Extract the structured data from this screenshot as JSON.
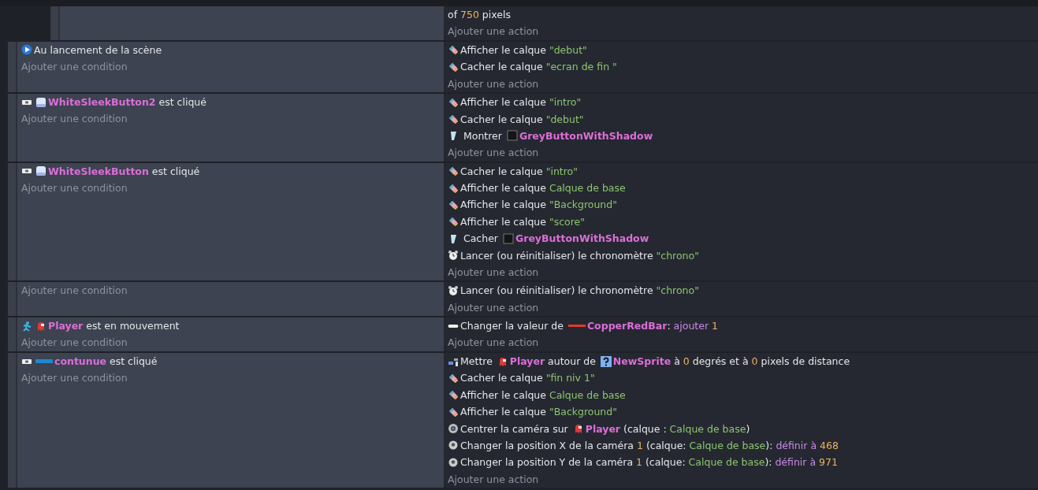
{
  "events": [
    {
      "kind": "sub-event",
      "actions": [
        {
          "kind": "continuation",
          "parts": [
            {
              "kind": "text",
              "text": "of "
            },
            {
              "kind": "number",
              "text": "750"
            },
            {
              "kind": "text",
              "text": " pixels"
            }
          ]
        }
      ],
      "add_action": "Ajouter une action"
    },
    {
      "kind": "event",
      "conditions": [
        {
          "kind": "scene-start",
          "parts": [
            {
              "kind": "text",
              "text": "Au lancement de la scène"
            }
          ]
        }
      ],
      "add_condition": "Ajouter une condition",
      "actions": [
        {
          "kind": "layer",
          "parts": [
            {
              "kind": "text",
              "text": "Afficher le calque "
            },
            {
              "kind": "string",
              "text": "\"debut\""
            }
          ]
        },
        {
          "kind": "layer",
          "parts": [
            {
              "kind": "text",
              "text": "Cacher le calque "
            },
            {
              "kind": "string",
              "text": "\"ecran de fin \""
            }
          ]
        }
      ],
      "add_action": "Ajouter une action"
    },
    {
      "kind": "event",
      "conditions": [
        {
          "kind": "mouse",
          "parts": [
            {
              "kind": "sleek-button"
            },
            {
              "kind": "object",
              "text": "WhiteSleekButton2"
            },
            {
              "kind": "text",
              "text": " est cliqué"
            }
          ]
        }
      ],
      "add_condition": "Ajouter une condition",
      "actions": [
        {
          "kind": "layer",
          "parts": [
            {
              "kind": "text",
              "text": "Afficher le calque "
            },
            {
              "kind": "string",
              "text": "\"intro\""
            }
          ]
        },
        {
          "kind": "layer",
          "parts": [
            {
              "kind": "text",
              "text": "Cacher le calque "
            },
            {
              "kind": "string",
              "text": "\"debut\""
            }
          ]
        },
        {
          "kind": "visibility",
          "parts": [
            {
              "kind": "text",
              "text": " Montrer "
            },
            {
              "kind": "dark-square"
            },
            {
              "kind": "object",
              "text": "GreyButtonWithShadow"
            }
          ]
        }
      ],
      "add_action": "Ajouter une action"
    },
    {
      "kind": "event",
      "conditions": [
        {
          "kind": "mouse",
          "parts": [
            {
              "kind": "sleek-button"
            },
            {
              "kind": "object",
              "text": "WhiteSleekButton"
            },
            {
              "kind": "text",
              "text": " est cliqué"
            }
          ]
        }
      ],
      "add_condition": "Ajouter une condition",
      "actions": [
        {
          "kind": "layer",
          "parts": [
            {
              "kind": "text",
              "text": "Cacher le calque "
            },
            {
              "kind": "string",
              "text": "\"intro\""
            }
          ]
        },
        {
          "kind": "layer",
          "parts": [
            {
              "kind": "text",
              "text": "Afficher le calque "
            },
            {
              "kind": "string",
              "text": "Calque de base"
            }
          ]
        },
        {
          "kind": "layer",
          "parts": [
            {
              "kind": "text",
              "text": "Afficher le calque "
            },
            {
              "kind": "string",
              "text": "\"Background\""
            }
          ]
        },
        {
          "kind": "layer",
          "parts": [
            {
              "kind": "text",
              "text": "Afficher le calque "
            },
            {
              "kind": "string",
              "text": "\"score\""
            }
          ]
        },
        {
          "kind": "visibility",
          "parts": [
            {
              "kind": "text",
              "text": " Cacher "
            },
            {
              "kind": "dark-square"
            },
            {
              "kind": "object",
              "text": "GreyButtonWithShadow"
            }
          ]
        },
        {
          "kind": "timer",
          "parts": [
            {
              "kind": "text",
              "text": "Lancer (ou réinitialiser) le chronomètre "
            },
            {
              "kind": "string",
              "text": "\"chrono\""
            }
          ]
        }
      ],
      "add_action": "Ajouter une action"
    },
    {
      "kind": "event",
      "add_condition": "Ajouter une condition",
      "actions": [
        {
          "kind": "timer",
          "parts": [
            {
              "kind": "text",
              "text": "Lancer (ou réinitialiser) le chronomètre "
            },
            {
              "kind": "string",
              "text": "\"chrono\""
            }
          ]
        }
      ],
      "add_action": "Ajouter une action"
    },
    {
      "kind": "event",
      "conditions": [
        {
          "kind": "moving",
          "parts": [
            {
              "kind": "red-sprite"
            },
            {
              "kind": "object",
              "text": "Player"
            },
            {
              "kind": "text",
              "text": " est en mouvement"
            }
          ]
        }
      ],
      "add_condition": "Ajouter une condition",
      "actions": [
        {
          "kind": "variable",
          "parts": [
            {
              "kind": "text",
              "text": "Changer la valeur de "
            },
            {
              "kind": "red-bar"
            },
            {
              "kind": "object",
              "text": "CopperRedBar"
            },
            {
              "kind": "text",
              "text": ": "
            },
            {
              "kind": "operator",
              "text": "ajouter "
            },
            {
              "kind": "number",
              "text": "1"
            }
          ]
        }
      ],
      "add_action": "Ajouter une action"
    },
    {
      "kind": "event",
      "conditions": [
        {
          "kind": "mouse",
          "parts": [
            {
              "kind": "blue-bar"
            },
            {
              "kind": "object",
              "text": "contunue"
            },
            {
              "kind": "text",
              "text": " est cliqué"
            }
          ]
        }
      ],
      "add_condition": "Ajouter une condition",
      "actions": [
        {
          "kind": "position",
          "parts": [
            {
              "kind": "text",
              "text": "Mettre "
            },
            {
              "kind": "red-sprite"
            },
            {
              "kind": "object",
              "text": "Player"
            },
            {
              "kind": "text",
              "text": " autour de "
            },
            {
              "kind": "unknown"
            },
            {
              "kind": "object",
              "text": "NewSprite"
            },
            {
              "kind": "text",
              "text": " à "
            },
            {
              "kind": "number",
              "text": "0"
            },
            {
              "kind": "text",
              "text": " degrés et à "
            },
            {
              "kind": "number",
              "text": "0"
            },
            {
              "kind": "text",
              "text": " pixels de distance"
            }
          ]
        },
        {
          "kind": "layer",
          "parts": [
            {
              "kind": "text",
              "text": "Cacher le calque "
            },
            {
              "kind": "string",
              "text": "\"fin niv 1\""
            }
          ]
        },
        {
          "kind": "layer",
          "parts": [
            {
              "kind": "text",
              "text": "Afficher le calque "
            },
            {
              "kind": "string",
              "text": "Calque de base"
            }
          ]
        },
        {
          "kind": "layer",
          "parts": [
            {
              "kind": "text",
              "text": "Afficher le calque "
            },
            {
              "kind": "string",
              "text": "\"Background\""
            }
          ]
        },
        {
          "kind": "camera-center",
          "parts": [
            {
              "kind": "text",
              "text": "Centrer la caméra sur "
            },
            {
              "kind": "red-sprite"
            },
            {
              "kind": "object",
              "text": "Player"
            },
            {
              "kind": "text",
              "text": " (calque : "
            },
            {
              "kind": "string",
              "text": "Calque de base"
            },
            {
              "kind": "text",
              "text": ")"
            }
          ]
        },
        {
          "kind": "camera",
          "parts": [
            {
              "kind": "text",
              "text": "Changer la position X de la caméra "
            },
            {
              "kind": "number",
              "text": "1"
            },
            {
              "kind": "text",
              "text": " (calque: "
            },
            {
              "kind": "string",
              "text": "Calque de base"
            },
            {
              "kind": "text",
              "text": "): "
            },
            {
              "kind": "operator",
              "text": "définir à "
            },
            {
              "kind": "number",
              "text": "468"
            }
          ]
        },
        {
          "kind": "camera",
          "parts": [
            {
              "kind": "text",
              "text": "Changer la position Y de la caméra "
            },
            {
              "kind": "number",
              "text": "1"
            },
            {
              "kind": "text",
              "text": " (calque: "
            },
            {
              "kind": "string",
              "text": "Calque de base"
            },
            {
              "kind": "text",
              "text": "): "
            },
            {
              "kind": "operator",
              "text": "définir à "
            },
            {
              "kind": "number",
              "text": "971"
            }
          ]
        }
      ],
      "add_action": "Ajouter une action"
    }
  ]
}
